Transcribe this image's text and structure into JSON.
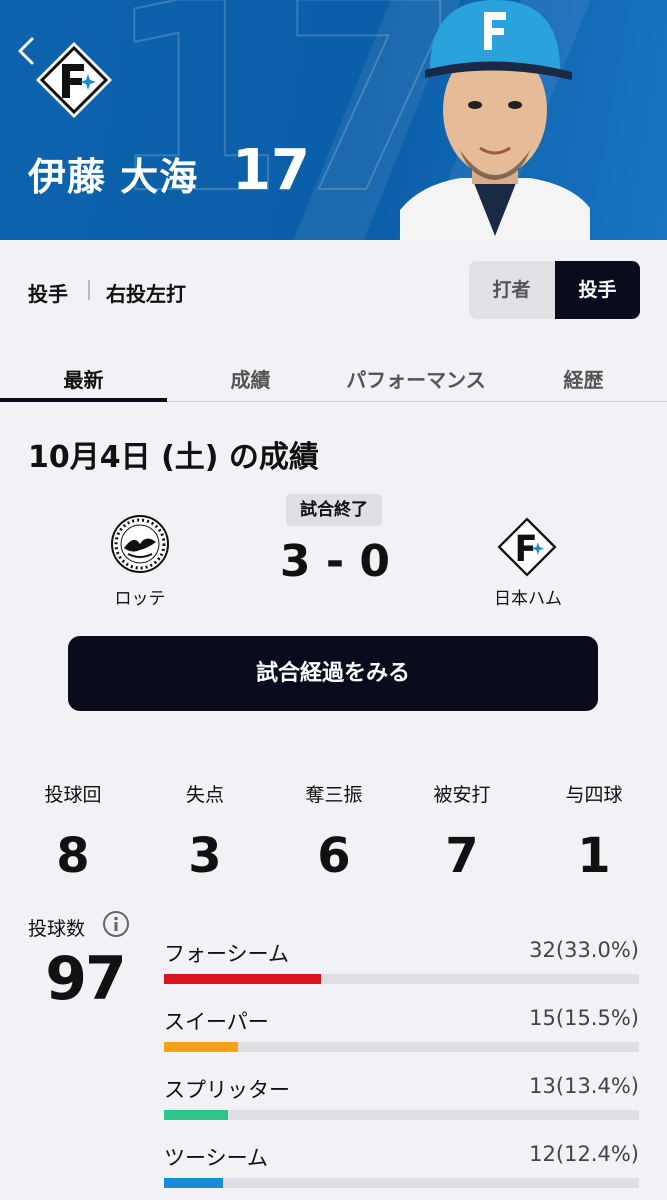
{
  "header": {
    "player_name": "伊藤 大海",
    "number": "17",
    "back_icon": "chevron-left-icon",
    "team_logo": "fighters-f-logo"
  },
  "profile": {
    "position": "投手",
    "handedness": "右投左打",
    "toggle": {
      "batter": "打者",
      "pitcher": "投手",
      "selected": "投手"
    }
  },
  "tabs": [
    "最新",
    "成績",
    "パフォーマンス",
    "経歴"
  ],
  "active_tab": "最新",
  "game": {
    "title": "10月4日 (土) の成績",
    "status": "試合終了",
    "score": "3 - 0",
    "away_team": "ロッテ",
    "home_team": "日本ハム",
    "button_label": "試合経過をみる"
  },
  "stats": [
    {
      "label": "投球回",
      "value": "8"
    },
    {
      "label": "失点",
      "value": "3"
    },
    {
      "label": "奪三振",
      "value": "6"
    },
    {
      "label": "被安打",
      "value": "7"
    },
    {
      "label": "与四球",
      "value": "1"
    }
  ],
  "pitch_count": {
    "label": "投球数",
    "value": "97",
    "info_icon": "info-icon"
  },
  "pitches": [
    {
      "name": "フォーシーム",
      "count": "32(33.0%)",
      "fraction": 0.33,
      "color": "#d9161c"
    },
    {
      "name": "スイーパー",
      "count": "15(15.5%)",
      "fraction": 0.155,
      "color": "#f5a21a"
    },
    {
      "name": "スプリッター",
      "count": "13(13.4%)",
      "fraction": 0.134,
      "color": "#2ec58a"
    },
    {
      "name": "ツーシーム",
      "count": "12(12.4%)",
      "fraction": 0.124,
      "color": "#1a8bd6"
    }
  ]
}
